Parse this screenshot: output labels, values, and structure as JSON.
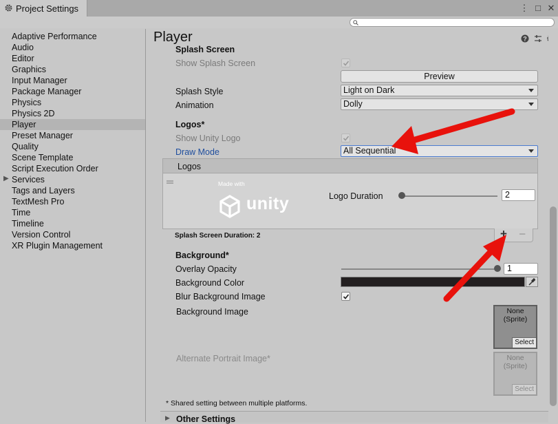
{
  "window": {
    "tab_title": "Project Settings",
    "buttons": [
      "⋮",
      "□",
      "✕"
    ]
  },
  "search": {
    "placeholder": "",
    "icon": "search-icon"
  },
  "sidebar": {
    "items": [
      {
        "label": "Adaptive Performance"
      },
      {
        "label": "Audio"
      },
      {
        "label": "Editor"
      },
      {
        "label": "Graphics"
      },
      {
        "label": "Input Manager"
      },
      {
        "label": "Package Manager"
      },
      {
        "label": "Physics"
      },
      {
        "label": "Physics 2D"
      },
      {
        "label": "Player",
        "selected": true
      },
      {
        "label": "Preset Manager"
      },
      {
        "label": "Quality"
      },
      {
        "label": "Scene Template"
      },
      {
        "label": "Script Execution Order"
      },
      {
        "label": "Services",
        "expandable": true
      },
      {
        "label": "Tags and Layers"
      },
      {
        "label": "TextMesh Pro"
      },
      {
        "label": "Time"
      },
      {
        "label": "Timeline"
      },
      {
        "label": "Version Control"
      },
      {
        "label": "XR Plugin Management"
      }
    ]
  },
  "main": {
    "title": "Player",
    "header_icons": [
      "help-icon",
      "presets-icon",
      "gear-icon"
    ],
    "splash": {
      "section_label": "Splash Screen",
      "show_splash_label": "Show Splash Screen",
      "show_splash_checked": true,
      "preview_label": "Preview",
      "splash_style_label": "Splash Style",
      "splash_style_value": "Light on Dark",
      "animation_label": "Animation",
      "animation_value": "Dolly"
    },
    "logos": {
      "section_label": "Logos*",
      "show_unity_logo_label": "Show Unity Logo",
      "show_unity_logo_checked": true,
      "draw_mode_label": "Draw Mode",
      "draw_mode_value": "All Sequential",
      "list_header": "Logos",
      "logo_made_with": "Made with",
      "logo_word": "unity",
      "logo_duration_label": "Logo Duration",
      "logo_duration_value": "2",
      "logo_duration_slider_fraction": 0.0,
      "splash_duration_label": "Splash Screen Duration: 2",
      "add_label": "+",
      "remove_label": "–"
    },
    "background": {
      "section_label": "Background*",
      "overlay_opacity_label": "Overlay Opacity",
      "overlay_opacity_value": "1",
      "overlay_opacity_fraction": 1.0,
      "bg_color_label": "Background Color",
      "bg_color_value": "#231f20",
      "blur_label": "Blur Background Image",
      "blur_checked": true,
      "bg_image_label": "Background Image",
      "bg_image_value_line1": "None",
      "bg_image_value_line2": "(Sprite)",
      "select_label": "Select",
      "alt_portrait_label": "Alternate Portrait Image*",
      "alt_value_line1": "None",
      "alt_value_line2": "(Sprite)",
      "alt_select_label": "Select"
    },
    "footnote": "* Shared setting between multiple platforms.",
    "other_settings_label": "Other Settings"
  },
  "annotations": {
    "arrow_color": "#e8120c"
  }
}
